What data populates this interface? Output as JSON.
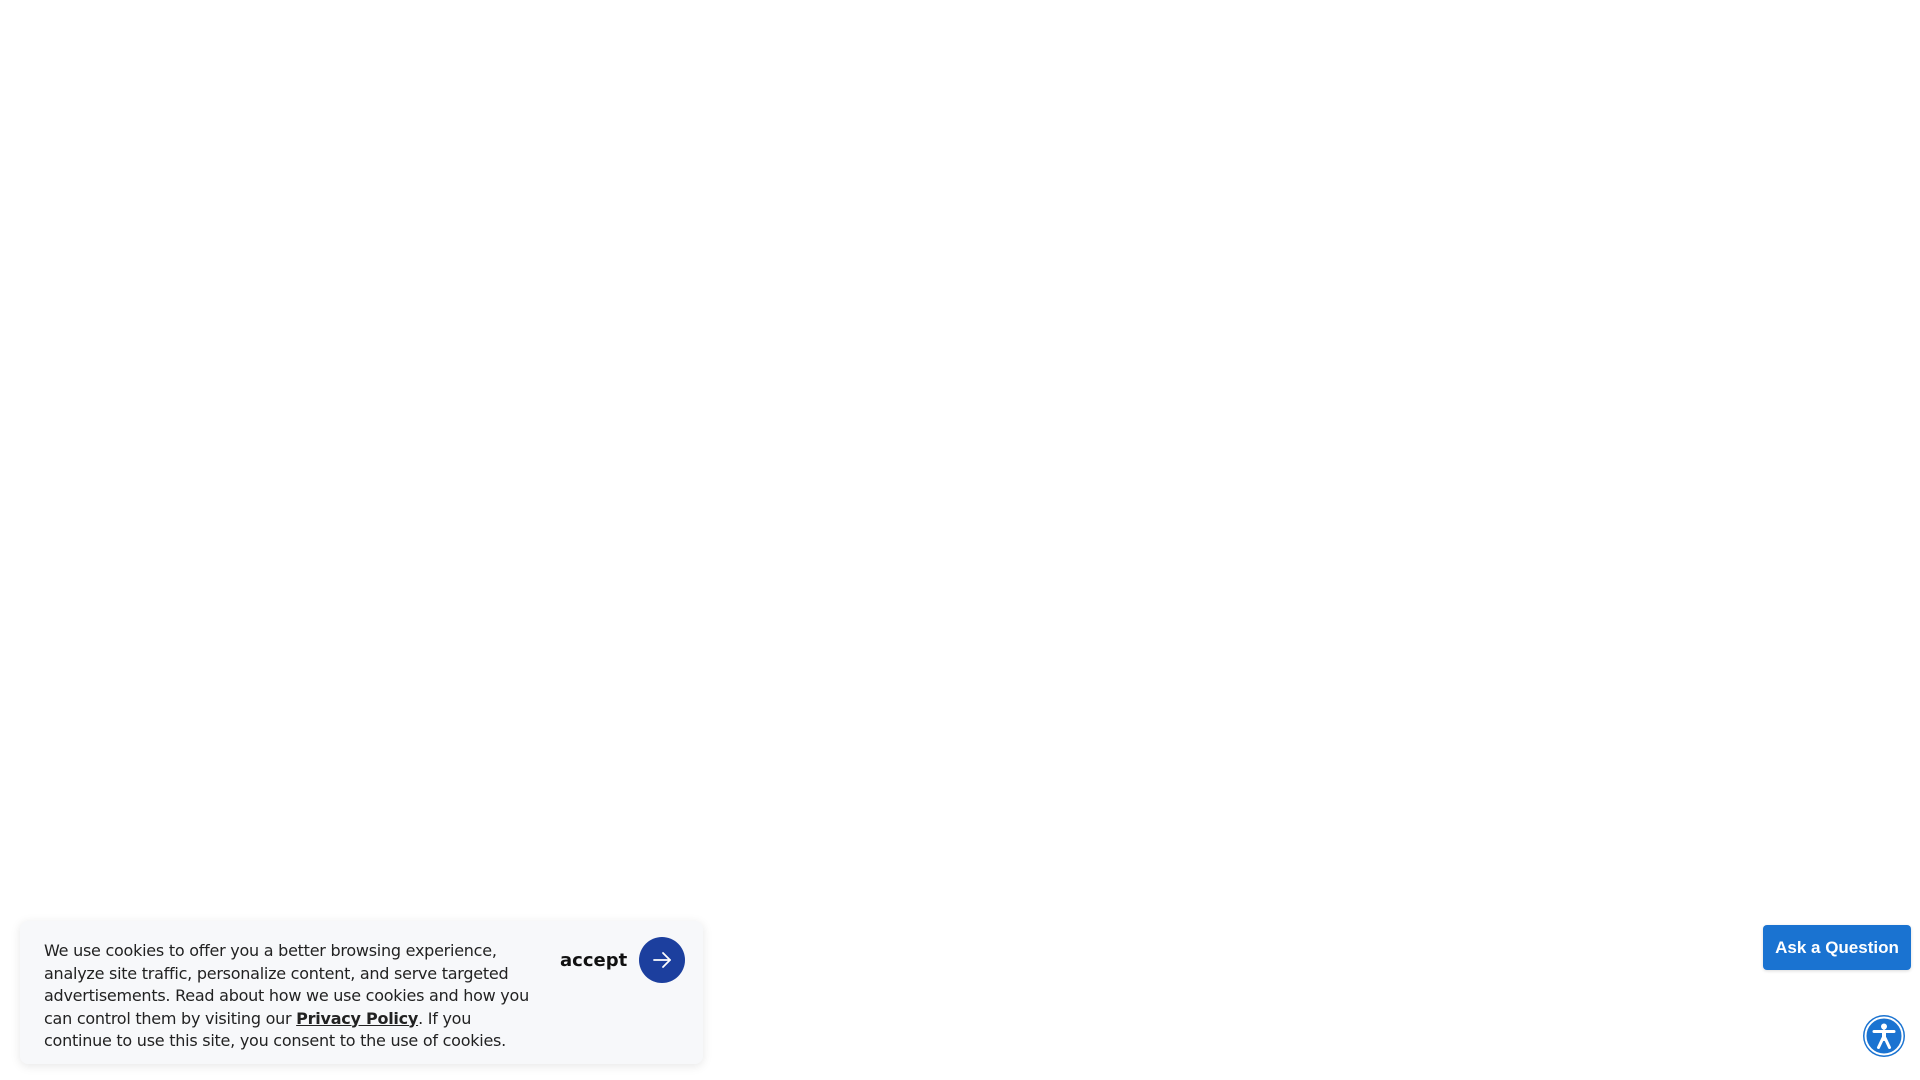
{
  "cookie_banner": {
    "text_before_link": "We use cookies to offer you a better browsing experience, analyze site traffic, personalize content, and serve targeted advertisements.  Read about how we use cookies and how you can control them by visiting our ",
    "privacy_link_label": "Privacy Policy",
    "text_after_link": ".  If you continue to use this site, you consent to the use of cookies.",
    "accept_label": "accept",
    "accept_icon": "arrow-right-icon",
    "accept_color": "#1c3f9e"
  },
  "ask_question": {
    "label": "Ask a Question",
    "color": "#1a73d1"
  },
  "accessibility": {
    "icon": "accessibility-icon",
    "color": "#1a73d1"
  }
}
